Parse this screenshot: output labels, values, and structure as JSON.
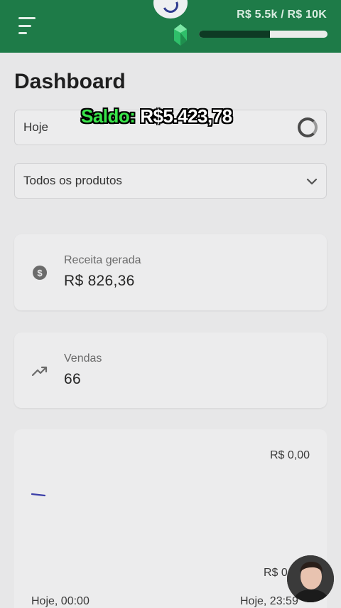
{
  "header": {
    "menu_icon": "hamburger-menu-icon",
    "logo_icon": "circle-logo-icon",
    "goal_text": "R$ 5.5k / R$ 10K",
    "goal_progress_fraction": 0.55,
    "gem_icon": "green-gem-icon",
    "brand_color": "#1e7b48"
  },
  "page": {
    "title": "Dashboard"
  },
  "overlay": {
    "saldo_label": "Saldo:",
    "saldo_value": "R$5.423,78"
  },
  "filters": {
    "date_value": "Hoje",
    "date_icon": "loading-spinner-icon",
    "product_value": "Todos os produtos",
    "product_icon": "chevron-down-icon"
  },
  "cards": {
    "revenue": {
      "icon": "dollar-coin-icon",
      "label": "Receita gerada",
      "value": "R$ 826,36"
    },
    "sales": {
      "icon": "trending-up-icon",
      "label": "Vendas",
      "value": "66"
    }
  },
  "chart": {
    "y_top_label": "R$ 0,00",
    "y_bottom_label": "R$ 0",
    "x_start_label": "Hoje, 00:00",
    "x_end_label": "Hoje, 23:59",
    "line_color": "#3b3fa8"
  }
}
